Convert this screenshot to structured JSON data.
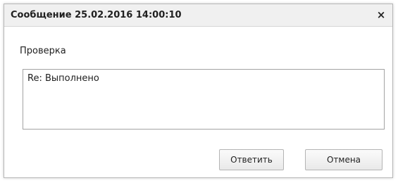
{
  "dialog": {
    "title": "Сообщение 25.02.2016 14:00:10",
    "close_symbol": "×",
    "close_icon": "close-icon",
    "subject": "Проверка",
    "message_text": "Re: Выполнено",
    "buttons": {
      "reply": "Ответить",
      "cancel": "Отмена"
    }
  },
  "colors": {
    "titlebar_bg": "#f0f0f0",
    "border": "#b6b6b6",
    "text": "#1f1f1f"
  }
}
